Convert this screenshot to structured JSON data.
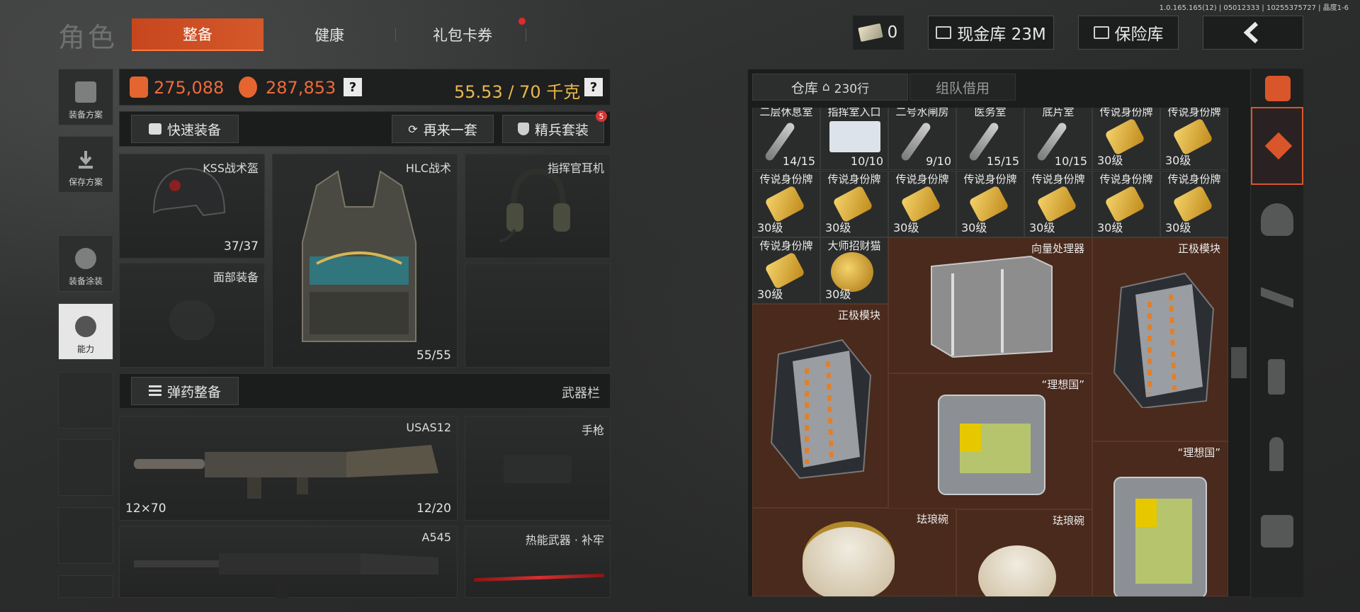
{
  "version": "1.0.165.165(12) | 05012333 | 10255375727 | 晶度1-6",
  "page_title": "角色",
  "tabs": [
    {
      "label": "整备",
      "active": true
    },
    {
      "label": "健康",
      "active": false
    },
    {
      "label": "礼包卡券",
      "active": false,
      "notification": true
    }
  ],
  "top_right": {
    "cash_count": "0",
    "cash_vault_label": "现金库 23M",
    "safe_label": "保险库"
  },
  "left_rail": [
    {
      "label": "装备方案"
    },
    {
      "label": "保存方案"
    },
    {
      "label": "装备涂装"
    },
    {
      "label": "能力",
      "active": true
    }
  ],
  "stats": {
    "value1": "275,088",
    "value2": "287,853",
    "weight": "55.53 / 70 千克"
  },
  "equip_bar": {
    "quick_equip": "快速装备",
    "again": "再来一套",
    "elite": "精兵套装",
    "elite_badge": "5"
  },
  "equip_slots": {
    "helmet": {
      "label": "KSS战术盔",
      "count": "37/37"
    },
    "armor": {
      "label": "HLC战术",
      "count": "55/55"
    },
    "headset": {
      "label": "指挥官耳机"
    },
    "face": {
      "label": "面部装备"
    }
  },
  "weapon_bar": {
    "ammo_equip": "弹药整备",
    "weapon_slot": "武器栏"
  },
  "weapons": {
    "primary": {
      "label": "USAS12",
      "ammo": "12×70",
      "count": "12/20"
    },
    "pistol": {
      "label": "手枪"
    },
    "secondary": {
      "label": "A545"
    },
    "melee": {
      "label": "热能武器 · 补牢"
    }
  },
  "warehouse": {
    "tab_label": "仓库",
    "tab_count": "230行",
    "team_tab": "组队借用",
    "cells": [
      {
        "name": "二层休息室",
        "count": "14/15"
      },
      {
        "name": "指挥室入口",
        "count": "10/10"
      },
      {
        "name": "二号水闸房",
        "count": "9/10"
      },
      {
        "name": "医务室",
        "count": "15/15"
      },
      {
        "name": "底片室",
        "count": "10/15"
      },
      {
        "name": "传说身份牌",
        "level": "30级"
      },
      {
        "name": "传说身份牌",
        "level": "30级"
      },
      {
        "name": "传说身份牌",
        "level": "30级"
      },
      {
        "name": "传说身份牌",
        "level": "30级"
      },
      {
        "name": "传说身份牌",
        "level": "30级"
      },
      {
        "name": "传说身份牌",
        "level": "30级"
      },
      {
        "name": "传说身份牌",
        "level": "30级"
      },
      {
        "name": "传说身份牌",
        "level": "30级"
      },
      {
        "name": "传说身份牌",
        "level": "30级"
      },
      {
        "name": "传说身份牌",
        "level": "30级"
      },
      {
        "name": "大师招财猫",
        "level": "30级"
      }
    ],
    "big_items": {
      "processor": "向量处理器",
      "module1": "正极模块",
      "module2": "正极模块",
      "case1": "“理想国”",
      "case2": "“理想国”",
      "bowl1": "珐琅碗",
      "bowl2": "珐琅碗"
    }
  },
  "colors": {
    "accent": "#d4592a",
    "value_orange": "#ee6b3a",
    "weight_gold": "#e8b94c",
    "badge_red": "#d53535"
  }
}
